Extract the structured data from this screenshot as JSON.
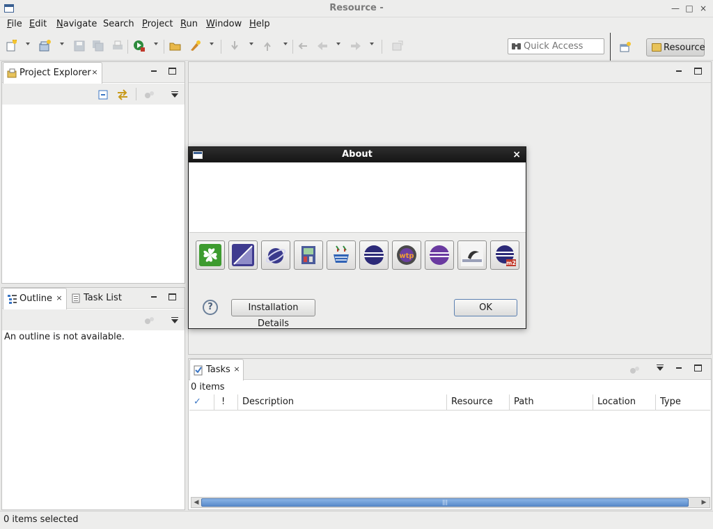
{
  "window": {
    "title": "Resource -",
    "buttons": {
      "minimize": "—",
      "maximize": "□",
      "close": "×"
    }
  },
  "menubar": {
    "items": [
      {
        "mnemonic": "F",
        "rest": "ile"
      },
      {
        "mnemonic": "E",
        "rest": "dit"
      },
      {
        "mnemonic": "N",
        "rest": "avigate"
      },
      {
        "mnemonic": "",
        "rest": "Search"
      },
      {
        "mnemonic": "P",
        "rest": "roject"
      },
      {
        "mnemonic": "R",
        "rest": "un"
      },
      {
        "mnemonic": "W",
        "rest": "indow"
      },
      {
        "mnemonic": "H",
        "rest": "elp"
      }
    ]
  },
  "toolbar": {
    "quick_access_placeholder": "Quick Access",
    "perspective_label": "Resource"
  },
  "project_explorer": {
    "tab_label": "Project Explorer",
    "close": "×"
  },
  "outline": {
    "tabs": [
      {
        "label": "Outline",
        "close": "×"
      },
      {
        "label": "Task List"
      }
    ],
    "empty_message": "An outline is not available."
  },
  "about_dialog": {
    "title": "About",
    "close": "×",
    "help": "?",
    "installation_details_label": "Installation Details",
    "ok_label": "OK",
    "feature_icons": [
      {
        "icon": "clover-feature-icon"
      },
      {
        "icon": "eclipse-sdk-feature-icon"
      },
      {
        "icon": "eclipse-platform-feature-icon"
      },
      {
        "icon": "equinox-feature-icon"
      },
      {
        "icon": "java-feature-icon"
      },
      {
        "icon": "eclipse-feature-icon"
      },
      {
        "icon": "wtp-feature-icon"
      },
      {
        "icon": "eclipse-purple-feature-icon"
      },
      {
        "icon": "code-recommenders-feature-icon"
      },
      {
        "icon": "m2e-feature-icon"
      }
    ]
  },
  "tasks": {
    "tab_label": "Tasks",
    "close": "×",
    "count": "0 items",
    "columns": [
      "✓",
      "!",
      "Description",
      "Resource",
      "Path",
      "Location",
      "Type"
    ],
    "scroll_grip": "|||"
  },
  "status_bar": {
    "text": "0 items selected"
  },
  "colors": {
    "accent_blue": "#3a75c4",
    "scrollbar": "#6a9ad4"
  }
}
